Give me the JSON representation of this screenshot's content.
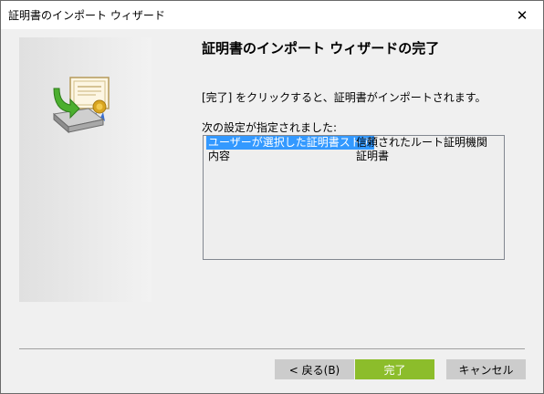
{
  "window": {
    "title": "証明書のインポート ウィザード",
    "close_symbol": "✕"
  },
  "main": {
    "heading": "証明書のインポート ウィザードの完了",
    "description": "[完了] をクリックすると、証明書がインポートされます。",
    "settings_label": "次の設定が指定されました:",
    "settings_rows": [
      {
        "name": "ユーザーが選択した証明書ストア",
        "value": "信頼されたルート証明機関"
      },
      {
        "name": "内容",
        "value": "証明書"
      }
    ]
  },
  "buttons": {
    "back": "< 戻る(B)",
    "finish": "完了",
    "cancel": "キャンセル"
  },
  "colors": {
    "accent_finish": "#8cbd2b",
    "selection": "#3399ff"
  },
  "icons": {
    "wizard": "certificate-import-icon"
  }
}
